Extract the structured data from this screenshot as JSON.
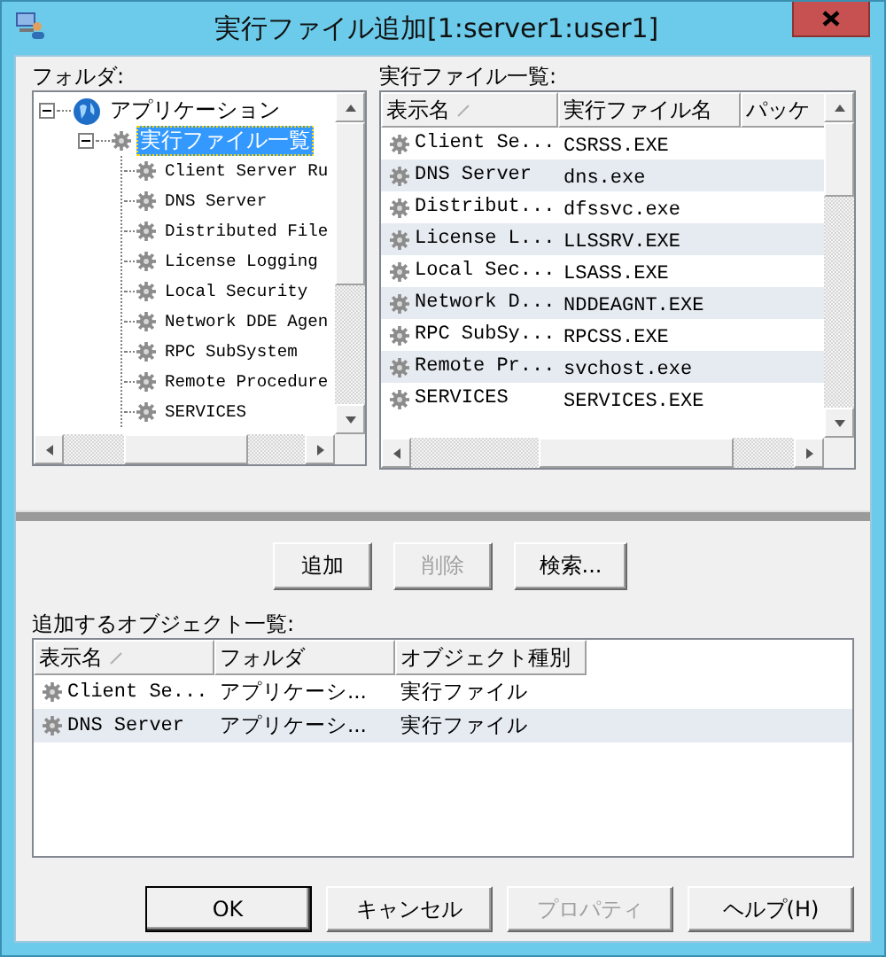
{
  "window": {
    "title": "実行ファイル追加[1:server1:user1]"
  },
  "folder_panel": {
    "label": "フォルダ:",
    "tree": [
      {
        "label": "アプリケーション",
        "kind": "globe",
        "expanded": true,
        "selected": false,
        "children": [
          {
            "label": "実行ファイル一覧",
            "kind": "gear",
            "expanded": true,
            "selected": true,
            "children": [
              {
                "label": "Client Server Ru",
                "kind": "gear",
                "selected": false
              },
              {
                "label": "DNS Server",
                "kind": "gear",
                "selected": false
              },
              {
                "label": "Distributed File",
                "kind": "gear",
                "selected": false
              },
              {
                "label": "License Logging",
                "kind": "gear",
                "selected": false
              },
              {
                "label": "Local Security",
                "kind": "gear",
                "selected": false
              },
              {
                "label": "Network DDE Agen",
                "kind": "gear",
                "selected": false
              },
              {
                "label": "RPC SubSystem",
                "kind": "gear",
                "selected": false
              },
              {
                "label": "Remote Procedure",
                "kind": "gear",
                "selected": false
              },
              {
                "label": "SERVICES",
                "kind": "gear",
                "selected": false
              }
            ]
          }
        ]
      }
    ]
  },
  "file_panel": {
    "label": "実行ファイル一覧:",
    "columns": [
      {
        "label": "表示名",
        "sorted": true
      },
      {
        "label": "実行ファイル名",
        "sorted": false
      },
      {
        "label": "パッケ",
        "sorted": false
      }
    ],
    "rows": [
      {
        "cells": [
          "Client Se...",
          "CSRSS.EXE"
        ]
      },
      {
        "cells": [
          "DNS Server",
          "dns.exe"
        ]
      },
      {
        "cells": [
          "Distribut...",
          "dfssvc.exe"
        ]
      },
      {
        "cells": [
          "License L...",
          "LLSSRV.EXE"
        ]
      },
      {
        "cells": [
          "Local Sec...",
          "LSASS.EXE"
        ]
      },
      {
        "cells": [
          "Network D...",
          "NDDEAGNT.EXE"
        ]
      },
      {
        "cells": [
          "RPC SubSy...",
          "RPCSS.EXE"
        ]
      },
      {
        "cells": [
          "Remote Pr...",
          "svchost.exe"
        ]
      },
      {
        "cells": [
          "SERVICES",
          "SERVICES.EXE"
        ]
      }
    ]
  },
  "action_buttons": [
    {
      "label": "追加",
      "disabled": false
    },
    {
      "label": "削除",
      "disabled": true
    },
    {
      "label": "検索...",
      "disabled": false
    }
  ],
  "objects_panel": {
    "label": "追加するオブジェクト一覧:",
    "columns": [
      {
        "label": "表示名",
        "sorted": true
      },
      {
        "label": "フォルダ",
        "sorted": false
      },
      {
        "label": "オブジェクト種別",
        "sorted": false
      }
    ],
    "rows": [
      {
        "cells": [
          "Client Se...",
          "アプリケーシ...",
          "実行ファイル"
        ]
      },
      {
        "cells": [
          "DNS Server",
          "アプリケーシ...",
          "実行ファイル"
        ]
      }
    ]
  },
  "footer_buttons": [
    {
      "label": "OK",
      "disabled": false,
      "default": true
    },
    {
      "label": "キャンセル",
      "disabled": false,
      "default": false
    },
    {
      "label": "プロパティ",
      "disabled": true,
      "default": false
    },
    {
      "label": "ヘルプ(H)",
      "disabled": false,
      "default": false
    }
  ]
}
